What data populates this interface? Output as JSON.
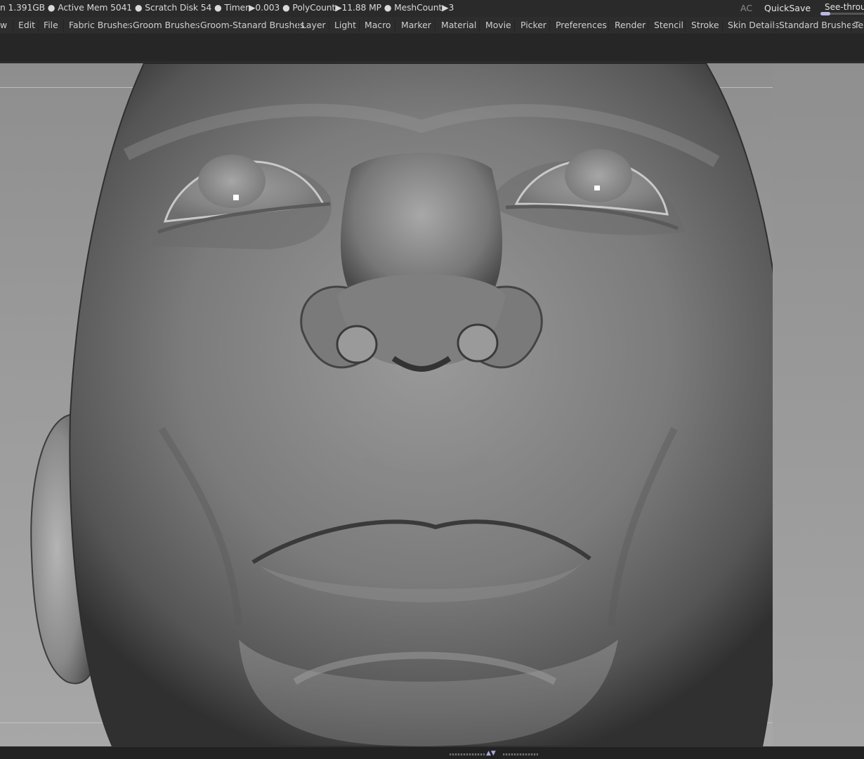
{
  "status": {
    "text": "n 1.391GB ● Active Mem 5041 ● Scratch Disk 54 ●  Timer▶0.003 ● PolyCount▶11.88 MP  ● MeshCount▶3",
    "ac": "AC",
    "quicksave": "QuickSave",
    "seethrough": "See-through",
    "seethrough_value": 0
  },
  "menu": [
    "w",
    "Edit",
    "File",
    "Fabric Brushes",
    "Groom Brushes",
    "Groom-Stanard Brushes",
    "Layer",
    "Light",
    "Macro",
    "Marker",
    "Material",
    "Movie",
    "Picker",
    "Preferences",
    "Render",
    "Stencil",
    "Stroke",
    "Skin Details",
    "Standard Brushes",
    "Te"
  ],
  "colors": {
    "accent": "#b9b9e6",
    "background": "#8e8e8e",
    "mesh": "#7d7d7d"
  },
  "canvas": {
    "subject": "sculpted-head-mesh"
  }
}
